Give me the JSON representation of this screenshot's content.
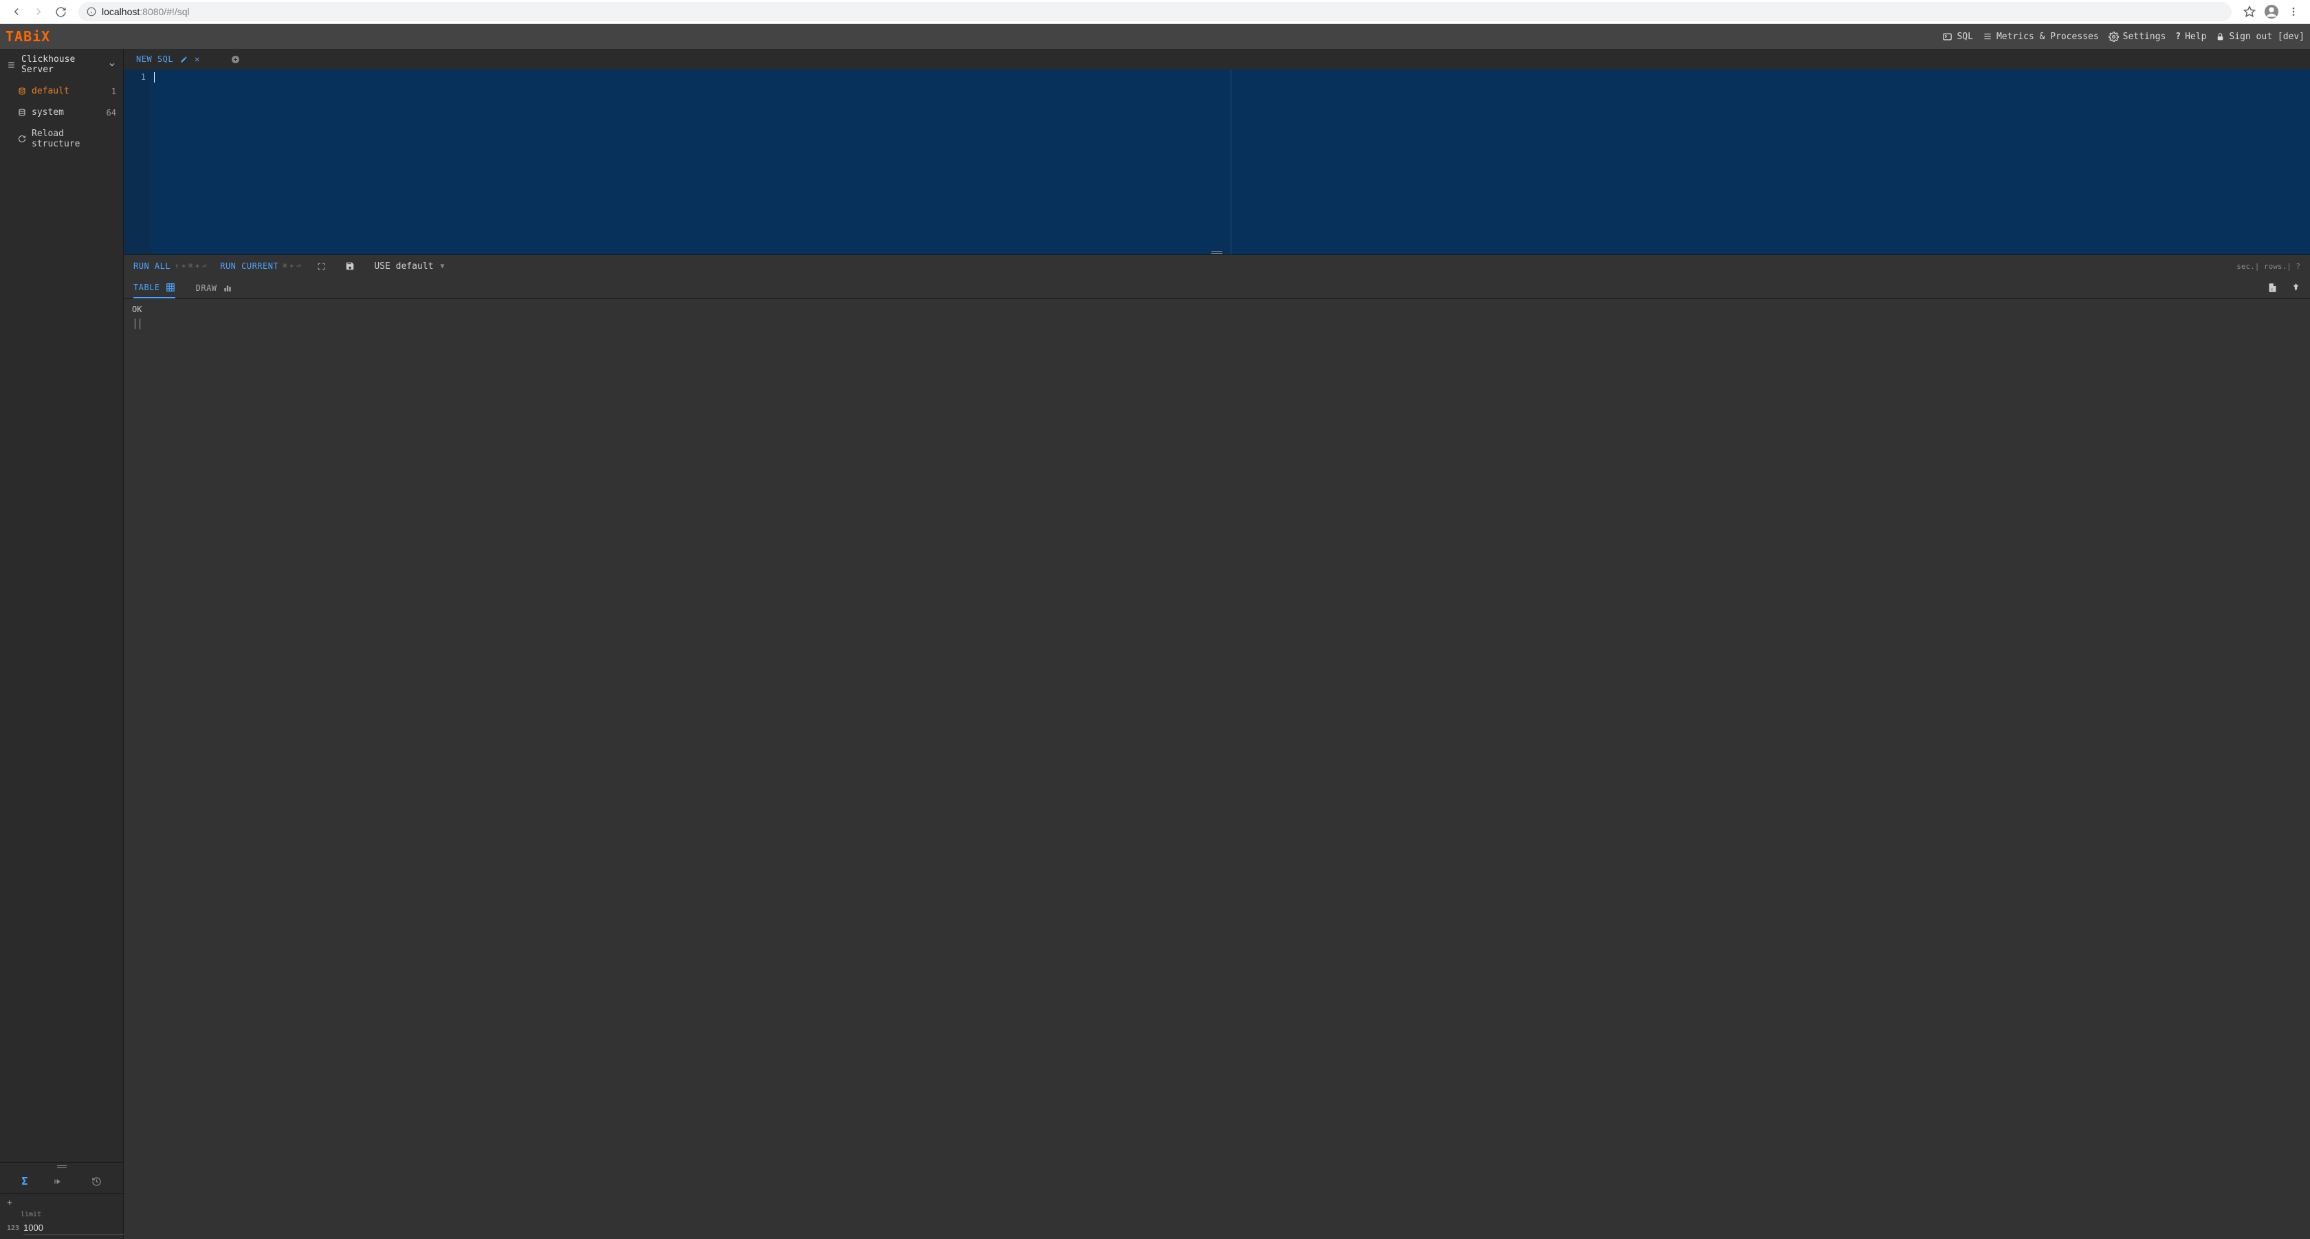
{
  "browser": {
    "url_host": "localhost",
    "url_path": ":8080/#!/sql"
  },
  "header": {
    "logo": "TABiX",
    "nav": {
      "sql": "SQL",
      "metrics": "Metrics & Processes",
      "settings": "Settings",
      "help": "Help",
      "signout": "Sign out [dev]"
    }
  },
  "sidebar": {
    "server": "Clickhouse Server",
    "databases": [
      {
        "name": "default",
        "count": "1",
        "active": true
      },
      {
        "name": "system",
        "count": "64",
        "active": false
      }
    ],
    "reload": "Reload structure",
    "limit_label": "limit",
    "limit_value": "1000",
    "num_prefix": "123"
  },
  "tabs": {
    "current": "NEW SQL"
  },
  "editor": {
    "line_number": "1"
  },
  "runbar": {
    "run_all": "RUN ALL",
    "run_current": "RUN CURRENT",
    "database_select": "USE default",
    "stats": "sec.| rows.| ?"
  },
  "result_tabs": {
    "table": "TABLE",
    "draw": "DRAW"
  },
  "result": {
    "status": "OK",
    "bars": "||"
  }
}
